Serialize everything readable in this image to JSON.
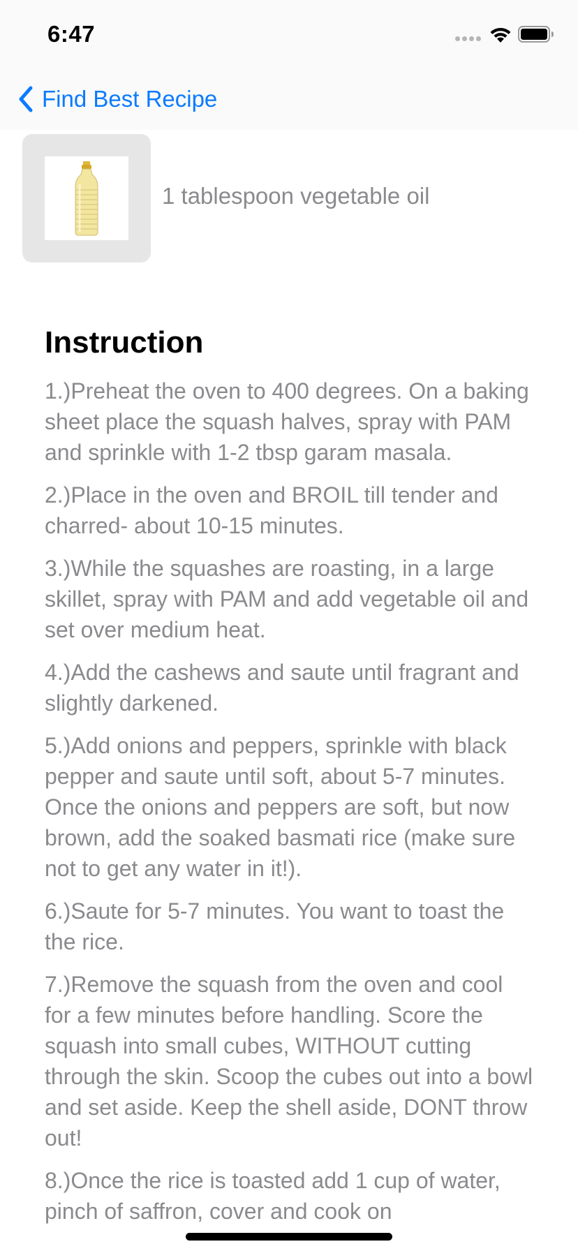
{
  "status_bar": {
    "time": "6:47"
  },
  "nav": {
    "back_label": "Find Best Recipe",
    "accent_color": "#0a7bff"
  },
  "ingredient": {
    "text": "1 tablespoon vegetable oil",
    "image_icon": "vegetable-oil-bottle"
  },
  "instruction": {
    "heading": "Instruction",
    "steps": [
      "1.)Preheat the oven to 400 degrees. On a baking sheet place the squash halves, spray with PAM and sprinkle with 1-2 tbsp garam masala.",
      "2.)Place in the oven and BROIL till tender and charred- about 10-15 minutes.",
      "3.)While the squashes are roasting, in a large skillet, spray with PAM and add vegetable oil and set over medium heat.",
      "4.)Add the cashews and saute until fragrant and slightly darkened.",
      "5.)Add onions and peppers, sprinkle with black pepper and saute until soft, about 5-7 minutes. Once the onions and peppers are soft, but now brown, add the soaked basmati rice (make sure not to get any water in it!).",
      "6.)Saute for 5-7 minutes. You want to toast the the rice.",
      "7.)Remove the squash from the oven and cool for a few minutes before handling. Score the squash into small cubes, WITHOUT cutting through the skin. Scoop the cubes out into a bowl and set aside. Keep the shell aside, DONT throw out!",
      "8.)Once the rice is toasted add 1 cup of water, pinch of saffron, cover and cook on"
    ]
  }
}
